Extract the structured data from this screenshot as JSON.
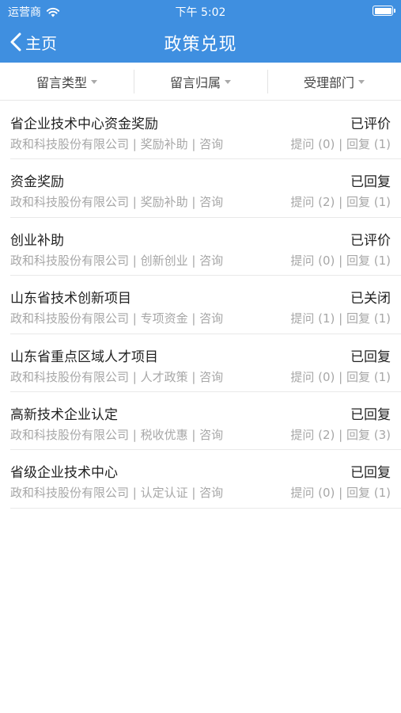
{
  "status_bar": {
    "carrier": "运营商",
    "time": "下午 5:02"
  },
  "nav": {
    "back_label": "主页",
    "title": "政策兑现"
  },
  "filters": [
    {
      "label": "留言类型"
    },
    {
      "label": "留言归属"
    },
    {
      "label": "受理部门"
    }
  ],
  "items": [
    {
      "title": "省企业技术中心资金奖励",
      "status": "已评价",
      "meta": "政和科技股份有限公司 | 奖励补助 | 咨询",
      "counts": "提问 (0) | 回复 (1)"
    },
    {
      "title": "资金奖励",
      "status": "已回复",
      "meta": "政和科技股份有限公司 | 奖励补助 | 咨询",
      "counts": "提问 (2) | 回复 (1)"
    },
    {
      "title": "创业补助",
      "status": "已评价",
      "meta": "政和科技股份有限公司 | 创新创业 | 咨询",
      "counts": "提问 (0) | 回复 (1)"
    },
    {
      "title": "山东省技术创新项目",
      "status": "已关闭",
      "meta": "政和科技股份有限公司 | 专项资金 | 咨询",
      "counts": "提问 (1) | 回复 (1)"
    },
    {
      "title": "山东省重点区域人才项目",
      "status": "已回复",
      "meta": "政和科技股份有限公司 | 人才政策 | 咨询",
      "counts": "提问 (0) | 回复 (1)"
    },
    {
      "title": "高新技术企业认定",
      "status": "已回复",
      "meta": "政和科技股份有限公司 | 税收优惠 | 咨询",
      "counts": "提问 (2) | 回复 (3)"
    },
    {
      "title": "省级企业技术中心",
      "status": "已回复",
      "meta": "政和科技股份有限公司 | 认定认证 | 咨询",
      "counts": "提问 (0) | 回复 (1)"
    }
  ],
  "colors": {
    "accent": "#3f8fe0",
    "muted": "#a7a7a7"
  }
}
